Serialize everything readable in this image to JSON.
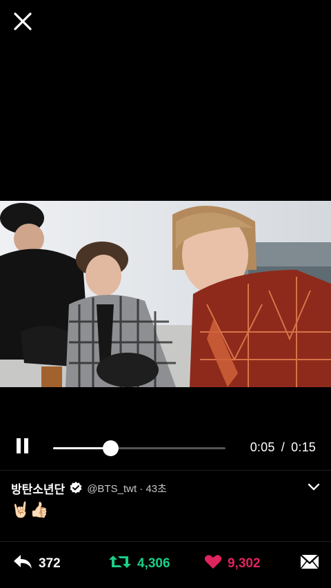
{
  "player": {
    "close_icon": "close-icon",
    "pause_icon": "pause-icon",
    "current_time": "0:05",
    "duration": "0:15",
    "time_separator": "/",
    "progress": 0.333
  },
  "tweet": {
    "display_name": "방탄소년단",
    "verified_icon": "verified-badge-icon",
    "handle": "@BTS_twt",
    "separator": "·",
    "time_ago": "43초",
    "text": "🤘🏻👍🏻",
    "menu_icon": "chevron-down-icon"
  },
  "actions": {
    "reply_count": "372",
    "retweet_count": "4,306",
    "like_count": "9,302",
    "reply_icon": "reply-icon",
    "retweet_icon": "retweet-icon",
    "like_icon": "heart-icon",
    "share_icon": "envelope-icon"
  },
  "colors": {
    "background": "#000000",
    "retweet": "#19cf86",
    "like": "#e0245e",
    "secondary_text": "#c7c7c7"
  }
}
